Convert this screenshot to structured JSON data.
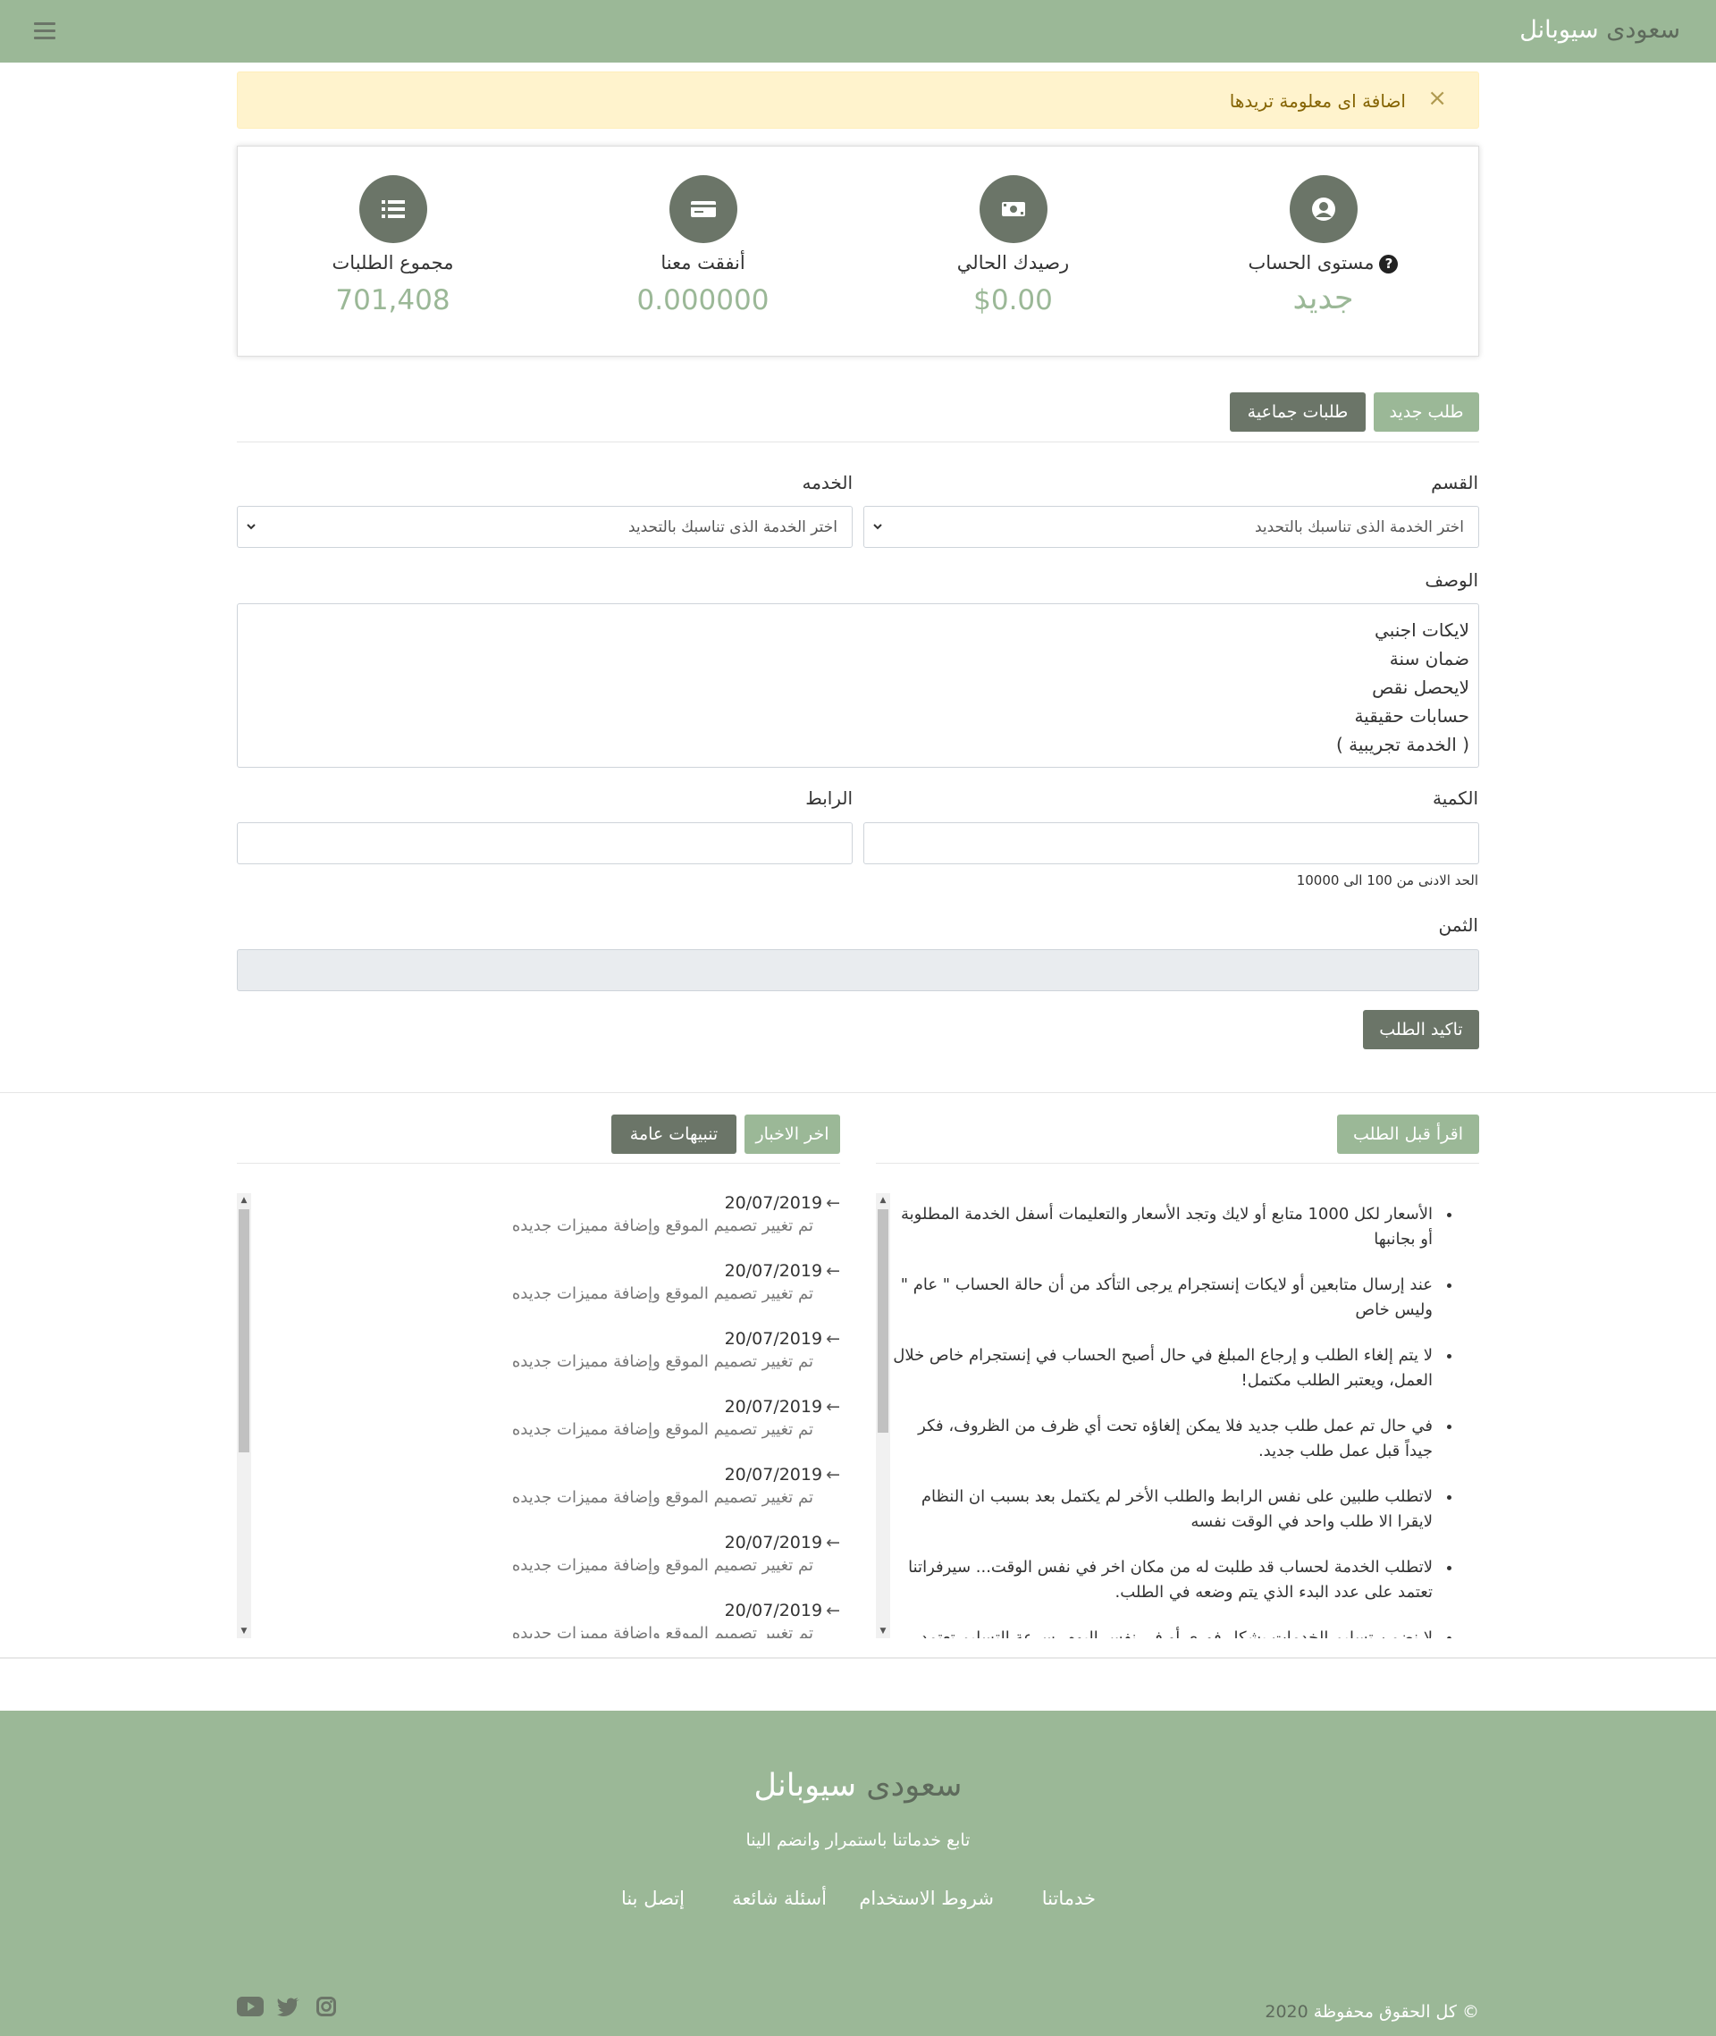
{
  "navbar": {
    "brand_part1": "سعودى",
    "brand_part2": "سيوبانل",
    "menu_icon": "bars-icon"
  },
  "alert": {
    "message": "اضافة اى معلومة تريدها",
    "close": "×"
  },
  "stats": [
    {
      "label": "مستوى الحساب",
      "value": "جديد",
      "icon": "user-circle-icon",
      "help_icon": "question-circle-icon"
    },
    {
      "label": "رصيدك الحالي",
      "value": "$0.00",
      "icon": "money-bill-icon"
    },
    {
      "label": "أنفقت معنا",
      "value": "0.000000",
      "icon": "credit-card-icon"
    },
    {
      "label": "مجموع الطلبات",
      "value": "701,408",
      "icon": "list-icon"
    }
  ],
  "order_tabs": {
    "new_order": "طلب جديد",
    "mass_order": "طلبات جماعية"
  },
  "form": {
    "category_label": "القسم",
    "category_value": "اختر الخدمة الذى تناسبك بالتحديد",
    "service_label": "الخدمه",
    "service_value": "اختر الخدمة الذى تناسبك بالتحديد",
    "description_label": "الوصف",
    "description_lines": [
      "لايكات اجنبي",
      "ضمان سنة",
      "لايحصل نقص",
      "حسابات حقيقية",
      "( الخدمة تجريبية )"
    ],
    "quantity_label": "الكمية",
    "quantity_help": "الحد الادنى من 100 الى 10000",
    "link_label": "الرابط",
    "price_label": "الثمن",
    "submit": "تاكيد الطلب"
  },
  "read_before": {
    "button": "اقرأ قبل الطلب",
    "rules": [
      "الأسعار لكل 1000 متابع أو لايك وتجد الأسعار والتعليمات أسفل الخدمة المطلوبة أو بجانبها",
      "عند إرسال متابعين أو لايكات إنستجرام يرجى التأكد من أن حالة الحساب \" عام \" وليس خاص",
      "لا يتم إلغاء الطلب و إرجاع المبلغ في حال أصبح الحساب في إنستجرام خاص خلال العمل، ويعتبر الطلب مكتمل!",
      "في حال تم عمل طلب جديد فلا يمكن إلغاؤه تحت أي ظرف من الظروف، فكر جيداً قبل عمل طلب جديد.",
      "لاتطلب طلبين على نفس الرابط والطلب الأخر لم يكتمل بعد بسبب ان النظام لايقرا الا طلب واحد في الوقت نفسه",
      "لاتطلب الخدمة لحساب قد طلبت له من مكان اخر في نفس الوقت... سيرفراتنا تعتمد على عدد البدء الذي يتم وضعه في الطلب.",
      "لا نضمن تسليم الخدمات بشكل فورى أو فى نفس اليوم، سرعة التسليم تعتمد"
    ]
  },
  "news": {
    "latest_button": "اخر الاخبار",
    "general_button": "تنبيهات عامة",
    "items": [
      {
        "date": "20/07/2019",
        "text": "تم تغيير تصميم الموقع وإضافة مميزات جديده"
      },
      {
        "date": "20/07/2019",
        "text": "تم تغيير تصميم الموقع وإضافة مميزات جديده"
      },
      {
        "date": "20/07/2019",
        "text": "تم تغيير تصميم الموقع وإضافة مميزات جديده"
      },
      {
        "date": "20/07/2019",
        "text": "تم تغيير تصميم الموقع وإضافة مميزات جديده"
      },
      {
        "date": "20/07/2019",
        "text": "تم تغيير تصميم الموقع وإضافة مميزات جديده"
      },
      {
        "date": "20/07/2019",
        "text": "تم تغيير تصميم الموقع وإضافة مميزات جديده"
      },
      {
        "date": "20/07/2019",
        "text": "تم تغيير تصميم الموقع وإضافة مميزات جديده"
      }
    ]
  },
  "footer": {
    "brand_part1": "سعودى",
    "brand_part2": "سيوبانل",
    "tagline": "تابع خدماتنا باستمرار وانضم الينا",
    "links": [
      "خدماتنا",
      "شروط الاستخدام",
      "أسئلة شائعة",
      "إتصل بنا"
    ],
    "copyright_prefix": "© كل الحقوق محفوظة",
    "copyright_year": "2020",
    "social": [
      "instagram-icon",
      "twitter-icon",
      "youtube-icon"
    ]
  },
  "colors": {
    "brand_green": "#9bb897",
    "dark_gray": "#6b7568",
    "alert_bg": "#fff3cd"
  }
}
